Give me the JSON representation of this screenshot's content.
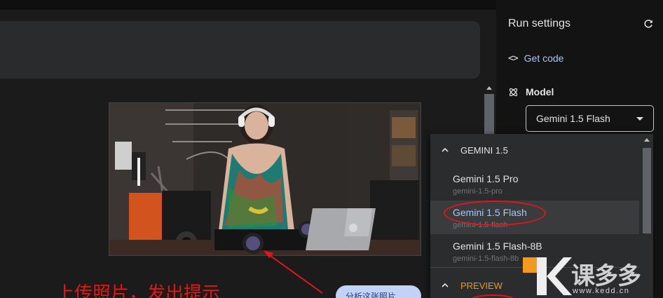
{
  "run_settings": {
    "title": "Run settings",
    "get_code_label": "Get code",
    "model_label": "Model",
    "selected_model": "Gemini 1.5 Flash"
  },
  "dropdown": {
    "groups": [
      {
        "label": "GEMINI 1.5",
        "options": [
          {
            "name": "Gemini 1.5 Pro",
            "id": "gemini-1.5-pro"
          },
          {
            "name": "Gemini 1.5 Flash",
            "id": "gemini-1.5-flash"
          },
          {
            "name": "Gemini 1.5 Flash-8B",
            "id": "gemini-1.5-flash-8b"
          }
        ]
      },
      {
        "label": "PREVIEW",
        "options": []
      }
    ],
    "selected_index": 1
  },
  "annotation": {
    "text": "上传照片，发出提示",
    "color": "#e8140e"
  },
  "suggestion_chip": {
    "label": "分析这张照片"
  },
  "watermark": {
    "brand": "课多多",
    "url": "www.kedd.cn"
  },
  "colors": {
    "accent": "#a8c7fa",
    "preview_label": "#f29900",
    "annotation_red": "#e3141b",
    "panel_bg": "#131314",
    "dropdown_bg": "#2b2c2e"
  }
}
